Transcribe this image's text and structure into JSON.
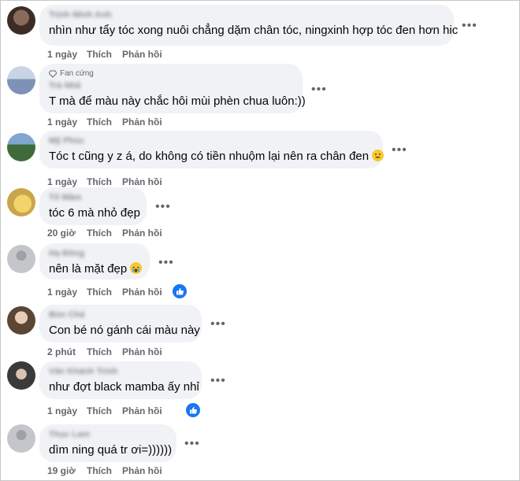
{
  "comments": [
    {
      "name": "Trịnh Minh Anh",
      "text": "nhìn như tẩy tóc xong nuôi chẳng dặm chân tóc, ningxinh hợp tóc đen hơn hic",
      "time": "1 ngày",
      "like": "Thích",
      "reply": "Phản hồi"
    },
    {
      "badge": "Fan cứng",
      "name": "Trà Nhã",
      "text": "T mà để màu này chắc hôi mùi phèn chua luôn:))",
      "time": "1 ngày",
      "like": "Thích",
      "reply": "Phản hồi"
    },
    {
      "name": "Mỹ Phúc",
      "text": "Tóc t cũng y z á, do không có tiền nhuộm lại nên ra chân đen",
      "emoji": "grinning-face",
      "time": "1 ngày",
      "like": "Thích",
      "reply": "Phản hồi"
    },
    {
      "name": "Tổ Mầm",
      "text": "tóc 6 mà nhỏ đẹp",
      "time": "20 giờ",
      "like": "Thích",
      "reply": "Phản hồi"
    },
    {
      "name": "Hạ Đông",
      "text": "nên là mặt đẹp",
      "emoji": "crying-face",
      "time": "1 ngày",
      "like": "Thích",
      "reply": "Phản hồi",
      "reaction": "like"
    },
    {
      "name": "Bún Chả",
      "text": "Con bé nó gánh cái màu này",
      "time": "2 phút",
      "like": "Thích",
      "reply": "Phản hồi"
    },
    {
      "name": "Văn Khánh Trình",
      "text": "như đợt black mamba ấy nhỉ",
      "time": "1 ngày",
      "like": "Thích",
      "reply": "Phản hồi",
      "reaction": "like"
    },
    {
      "name": "Thục Lam",
      "text": "dìm ning quá tr ơi=))))))",
      "time": "19 giờ",
      "like": "Thích",
      "reply": "Phản hồi"
    }
  ],
  "more_label": "•••",
  "colors": {
    "bubble": "#f0f2f5",
    "meta": "#65676b",
    "like_blue": "#1877f2"
  }
}
